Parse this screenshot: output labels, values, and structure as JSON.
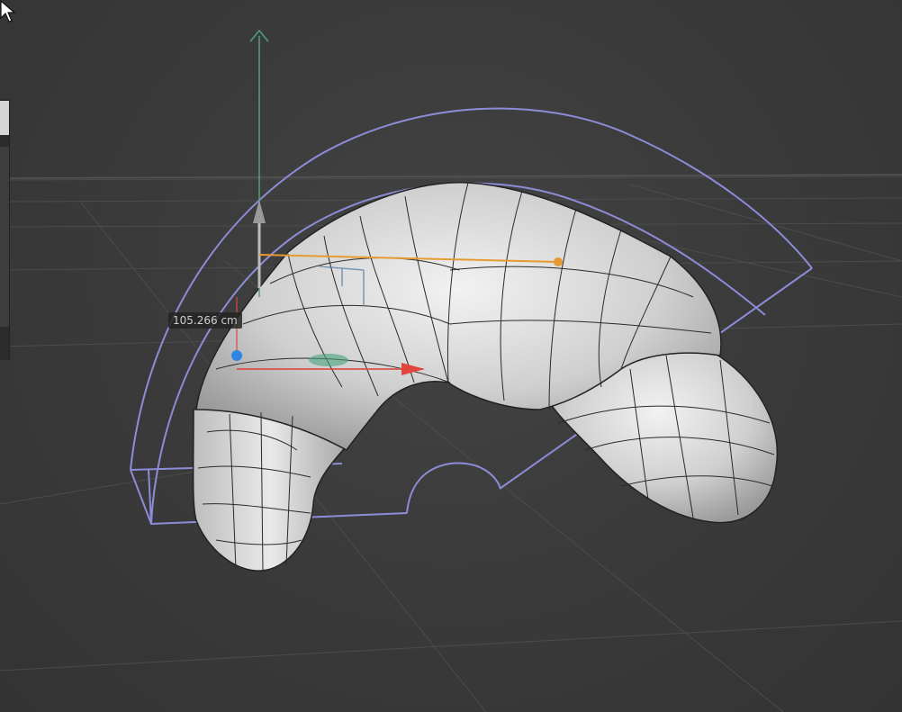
{
  "viewport": {
    "measurement_label": "105.266 cm",
    "axis_colors": {
      "x": "#e0463e",
      "y": "#4aa37c",
      "z": "#2f86e0",
      "handle": "#e79a32"
    },
    "bounds_color": "#8c8cd8",
    "grid_color": "#4a4a4a",
    "mesh_color": "#d9d9d9",
    "cursor_icon": "arrow-pointer-icon"
  }
}
